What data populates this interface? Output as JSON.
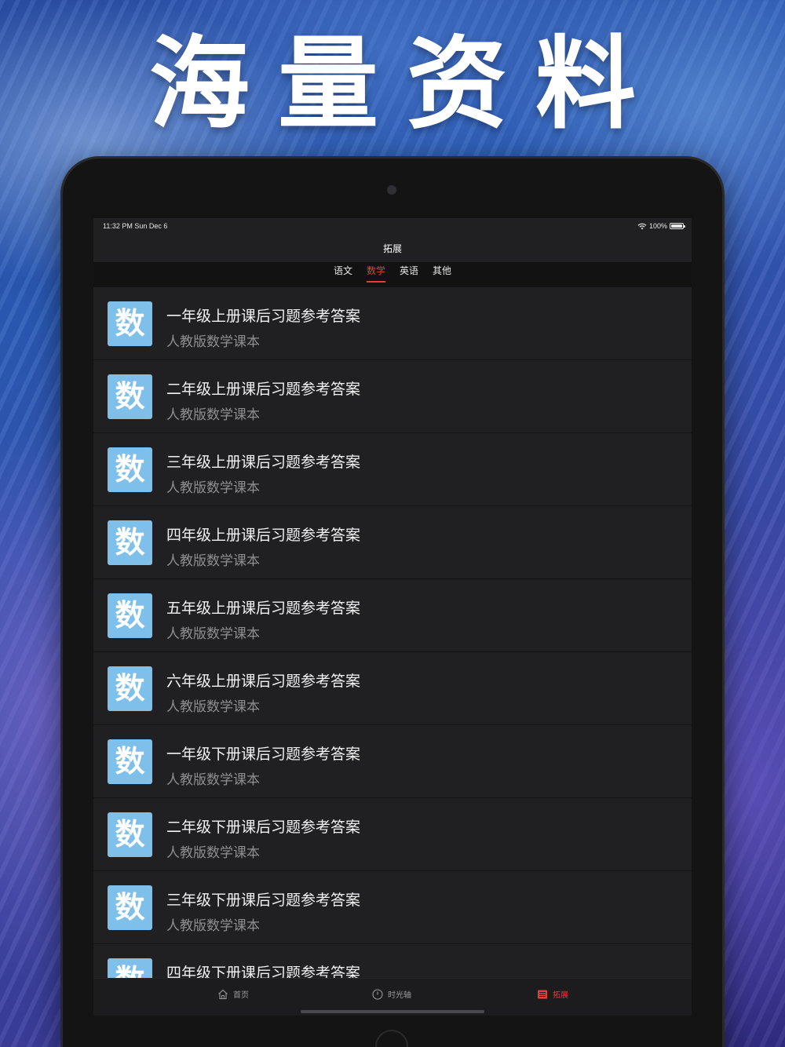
{
  "promo": {
    "headline": "海量资料"
  },
  "status_bar": {
    "time": "11:32 PM   Sun Dec 6",
    "battery": "100%"
  },
  "nav": {
    "title": "拓展"
  },
  "segment_tabs": [
    {
      "label": "语文",
      "active": false
    },
    {
      "label": "数学",
      "active": true
    },
    {
      "label": "英语",
      "active": false
    },
    {
      "label": "其他",
      "active": false
    }
  ],
  "list": {
    "items": [
      {
        "icon_text": "数",
        "title": "一年级上册课后习题参考答案",
        "subtitle": "人教版数学课本"
      },
      {
        "icon_text": "数",
        "title": "二年级上册课后习题参考答案",
        "subtitle": "人教版数学课本"
      },
      {
        "icon_text": "数",
        "title": "三年级上册课后习题参考答案",
        "subtitle": "人教版数学课本"
      },
      {
        "icon_text": "数",
        "title": "四年级上册课后习题参考答案",
        "subtitle": "人教版数学课本"
      },
      {
        "icon_text": "数",
        "title": "五年级上册课后习题参考答案",
        "subtitle": "人教版数学课本"
      },
      {
        "icon_text": "数",
        "title": "六年级上册课后习题参考答案",
        "subtitle": "人教版数学课本"
      },
      {
        "icon_text": "数",
        "title": "一年级下册课后习题参考答案",
        "subtitle": "人教版数学课本"
      },
      {
        "icon_text": "数",
        "title": "二年级下册课后习题参考答案",
        "subtitle": "人教版数学课本"
      },
      {
        "icon_text": "数",
        "title": "三年级下册课后习题参考答案",
        "subtitle": "人教版数学课本"
      },
      {
        "icon_text": "数",
        "title": "四年级下册课后习题参考答案",
        "subtitle": ""
      }
    ]
  },
  "bottom_tabs": [
    {
      "label": "首页",
      "icon": "home-icon",
      "active": false
    },
    {
      "label": "时光轴",
      "icon": "clock-icon",
      "active": false
    },
    {
      "label": "拓展",
      "icon": "list-icon",
      "active": true
    }
  ],
  "colors": {
    "accent": "#e0403a",
    "icon_bg": "#7fc0ea",
    "list_bg": "#202022"
  }
}
